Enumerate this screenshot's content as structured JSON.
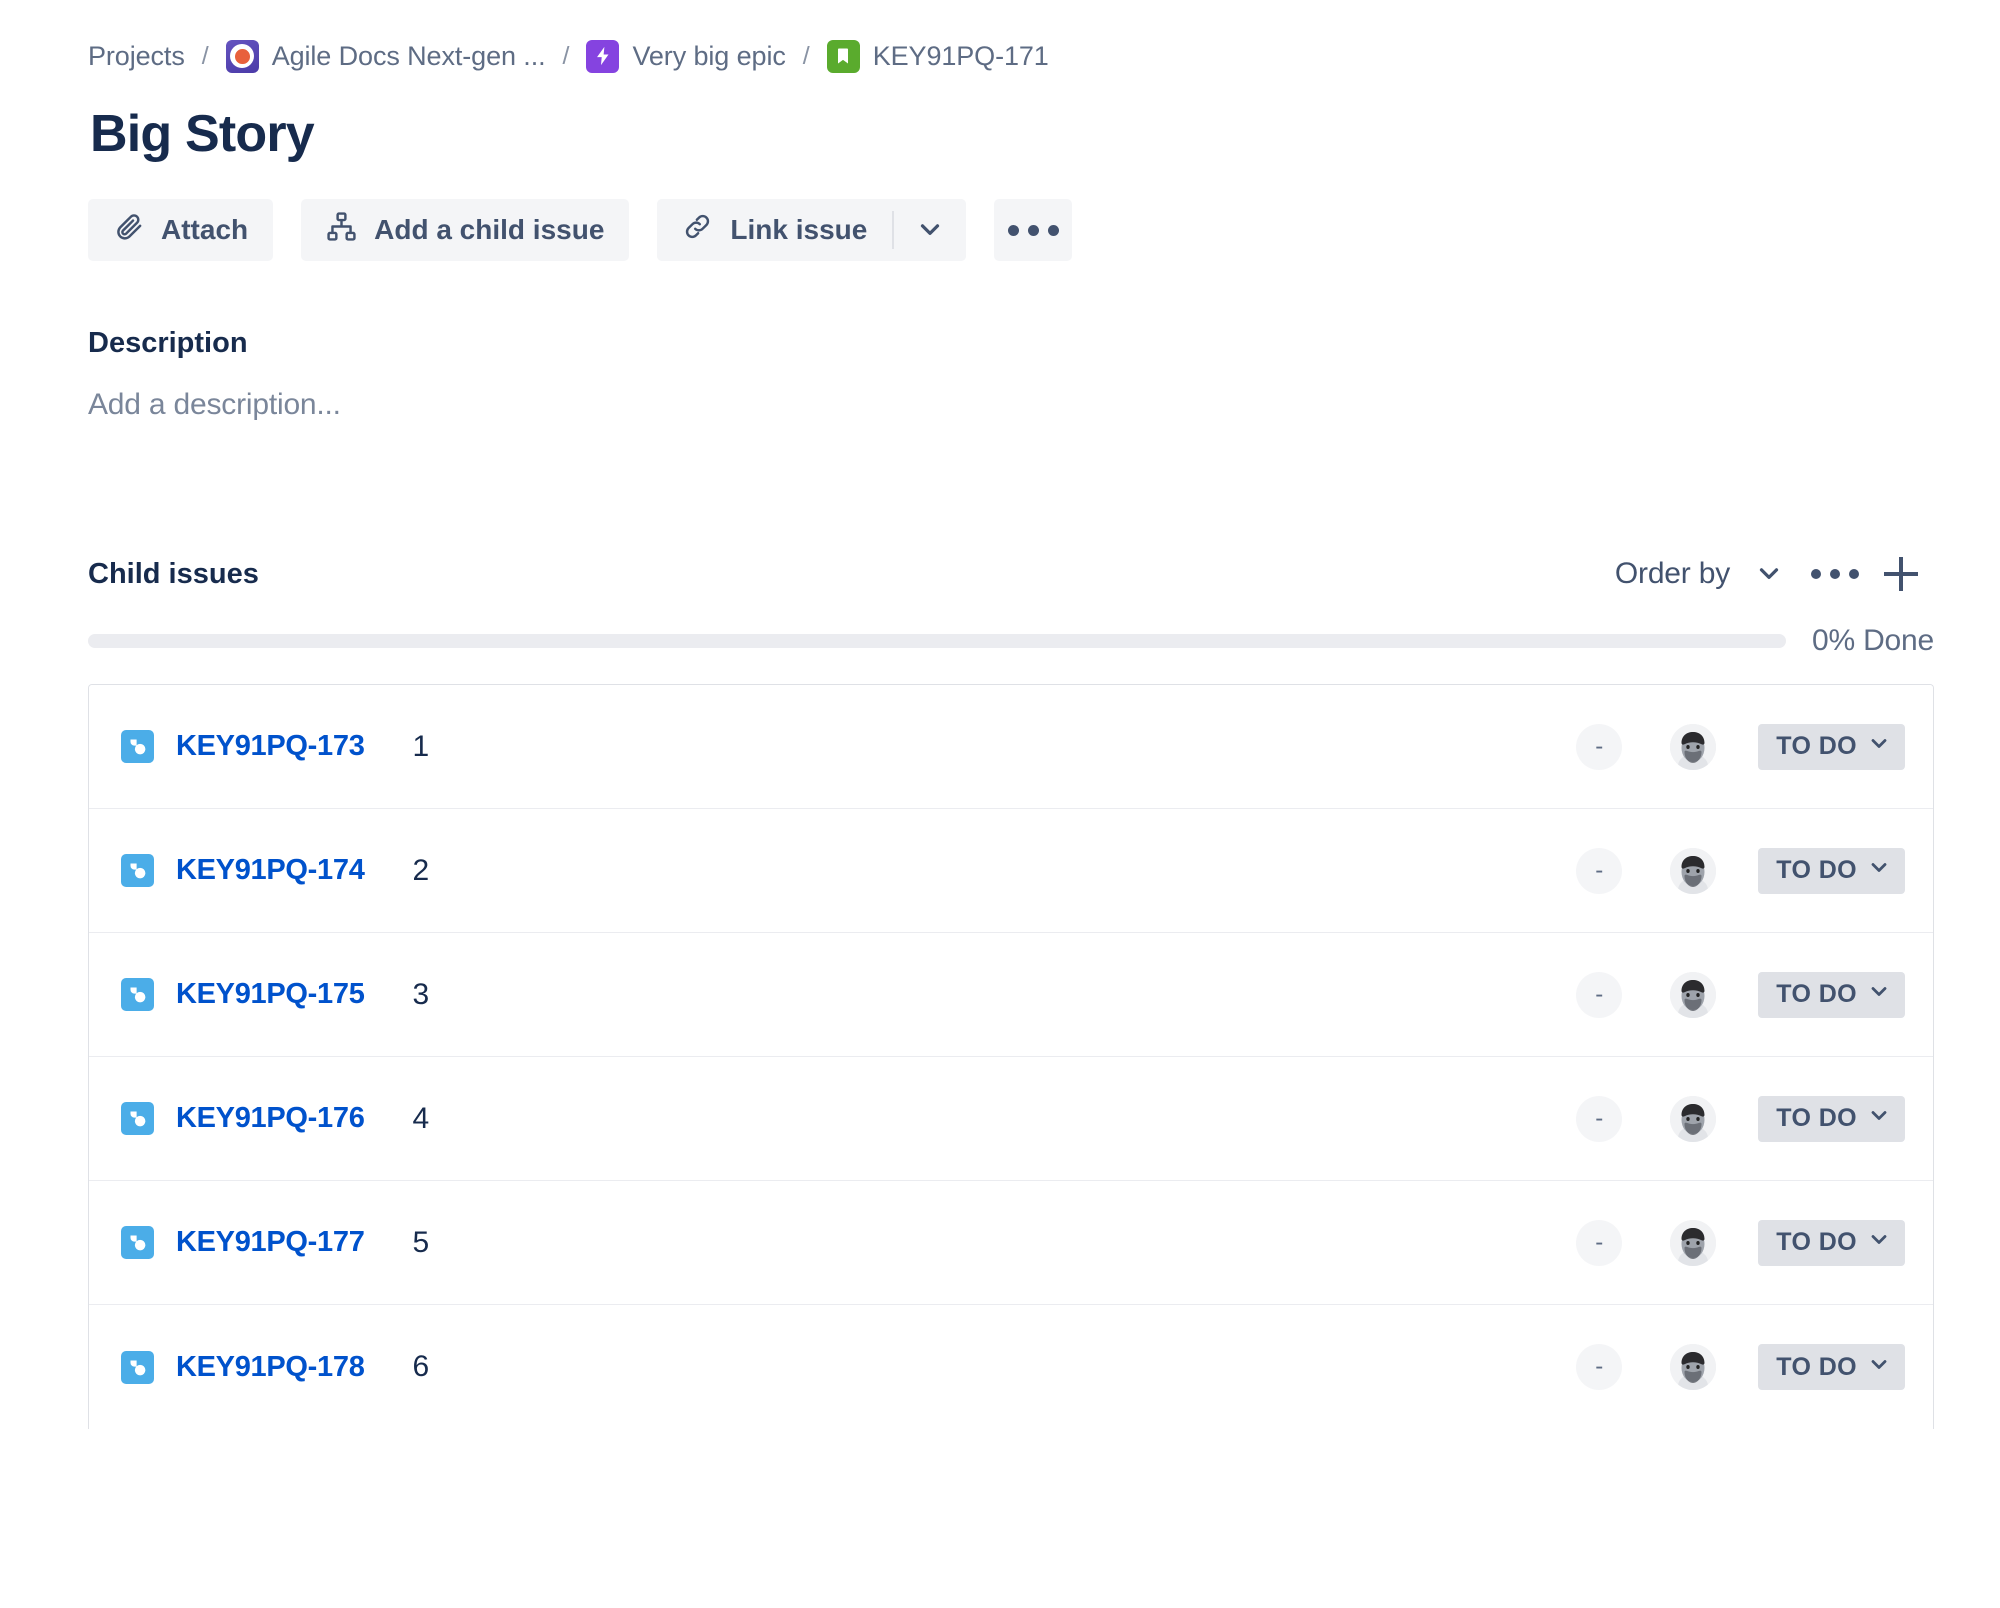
{
  "breadcrumb": {
    "root_label": "Projects",
    "separator": "/",
    "project_label": "Agile Docs Next-gen ...",
    "epic_label": "Very big epic",
    "issue_label": "KEY91PQ-171",
    "project_icon": "project-avatar-icon",
    "epic_icon": "epic-bolt-icon",
    "issue_icon": "story-bookmark-icon"
  },
  "header": {
    "title": "Big Story"
  },
  "toolbar": {
    "attach_label": "Attach",
    "attach_icon": "paperclip-icon",
    "add_child_label": "Add a child issue",
    "add_child_icon": "hierarchy-icon",
    "link_issue_label": "Link issue",
    "link_issue_icon": "link-icon",
    "dropdown_icon": "chevron-down-icon",
    "more_icon": "ellipsis-icon"
  },
  "description": {
    "label": "Description",
    "placeholder": "Add a description..."
  },
  "child_issues": {
    "label": "Child issues",
    "order_by_label": "Order by",
    "order_by_icon": "chevron-down-icon",
    "more_icon": "ellipsis-icon",
    "add_icon": "plus-icon",
    "progress_percent": 0,
    "progress_label": "0% Done",
    "status_default": "TO DO",
    "status_chevron_icon": "chevron-down-icon",
    "estimate_placeholder": "-",
    "assignee_icon": "avatar",
    "item_icon": "subtask-icon",
    "rows": [
      {
        "key": "KEY91PQ-173",
        "summary": "1",
        "estimate": "-",
        "status": "TO DO"
      },
      {
        "key": "KEY91PQ-174",
        "summary": "2",
        "estimate": "-",
        "status": "TO DO"
      },
      {
        "key": "KEY91PQ-175",
        "summary": "3",
        "estimate": "-",
        "status": "TO DO"
      },
      {
        "key": "KEY91PQ-176",
        "summary": "4",
        "estimate": "-",
        "status": "TO DO"
      },
      {
        "key": "KEY91PQ-177",
        "summary": "5",
        "estimate": "-",
        "status": "TO DO"
      },
      {
        "key": "KEY91PQ-178",
        "summary": "6",
        "estimate": "-",
        "status": "TO DO"
      }
    ]
  },
  "colors": {
    "link": "#0052CC",
    "text": "#172B4D",
    "muted": "#5E6C84",
    "button_bg": "#F4F5F7",
    "badge_bg": "#DFE1E6",
    "epic_purple": "#8543E0",
    "story_green": "#5AAB2D",
    "subtask_blue": "#4BADE8"
  }
}
